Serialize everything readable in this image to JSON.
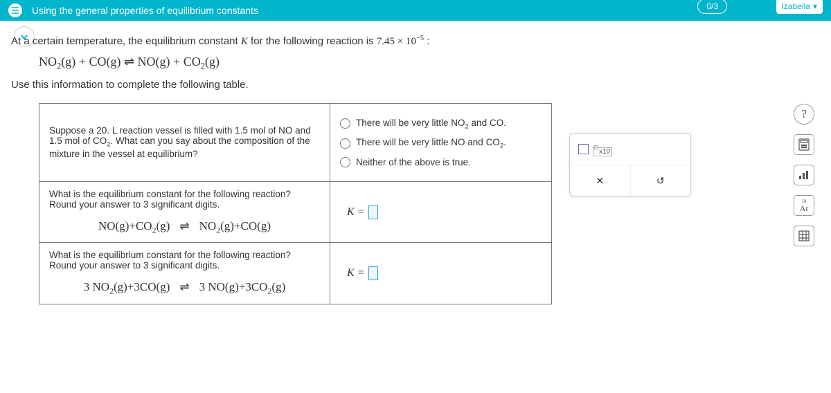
{
  "header": {
    "title": "Using the general properties of equilibrium constants",
    "progress": "0/3",
    "user": "Izabella"
  },
  "problem": {
    "intro_prefix": "At a certain temperature, the equilibrium constant ",
    "intro_k": "K",
    "intro_mid": " for the following reaction is ",
    "k_value_base": "7.45 × 10",
    "k_value_exp": "−5",
    "intro_suffix": " :",
    "reaction_lhs1": "NO",
    "reaction_sub1": "2",
    "reaction_state": "(g)",
    "reaction_plus": " + ",
    "reaction_co": "CO(g)",
    "reaction_arrow": "⇌",
    "reaction_no": "NO(g)",
    "reaction_co2": "CO",
    "reaction_co2_sub": "2",
    "instruction": "Use this information to complete the following table."
  },
  "rows": {
    "r1": {
      "prompt_a": "Suppose a 20. L reaction vessel is filled with 1.5 mol of NO and 1.5 mol of CO",
      "prompt_sub": "2",
      "prompt_b": ". What can you say about the composition of the mixture in the vessel at equilibrium?",
      "opt1_a": "There will be very little NO",
      "opt1_sub": "2",
      "opt1_b": " and CO.",
      "opt2_a": "There will be very little NO and CO",
      "opt2_sub": "2",
      "opt2_b": ".",
      "opt3": "Neither of the above is true."
    },
    "r2": {
      "prompt_a": "What is the equilibrium constant for the following reaction?",
      "prompt_b": "Round your answer to 3 significant digits.",
      "lhs": "NO(g)+CO",
      "lhs_sub": "2",
      "lhs_tail": "(g)",
      "rhs": "NO",
      "rhs_sub": "2",
      "rhs_tail": "(g)+CO(g)",
      "k_label": "K ="
    },
    "r3": {
      "prompt_a": "What is the equilibrium constant for the following reaction?",
      "prompt_b": "Round your answer to 3 significant digits.",
      "lhs": "3 NO",
      "lhs_sub": "2",
      "lhs_tail": "(g)+3CO(g)",
      "rhs": "3 NO(g)+3CO",
      "rhs_sub": "2",
      "rhs_tail": "(g)",
      "k_label": "K ="
    }
  },
  "tools": {
    "x10": "x10",
    "close": "✕",
    "redo": "↺"
  },
  "rail": {
    "help": "?",
    "calc": "⌨",
    "bars": "o0o",
    "ar_sup": "18",
    "ar": "Ar",
    "table": "▦"
  }
}
